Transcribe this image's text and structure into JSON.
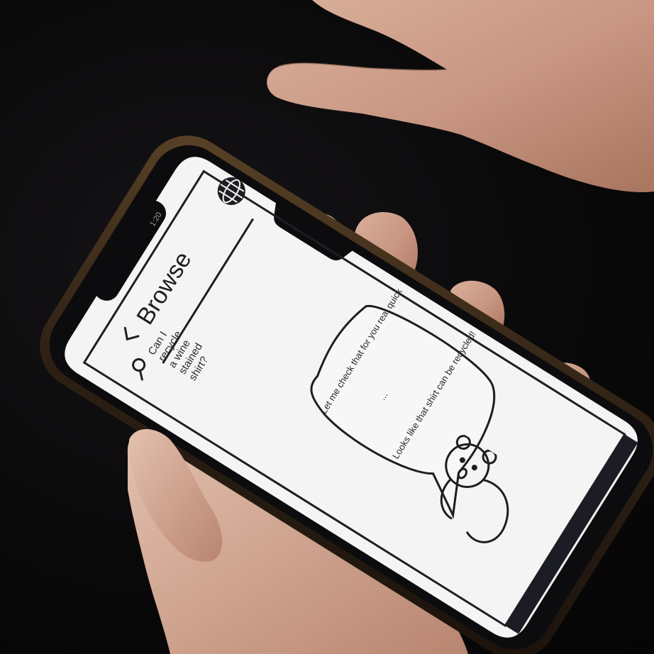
{
  "status_bar": {
    "time": "1:20"
  },
  "header": {
    "back_icon": "chevron-left-icon",
    "title": "Browse",
    "globe_icon": "globe-icon"
  },
  "search": {
    "icon": "search-icon",
    "query": "Can I recycle a wine stained shirt?"
  },
  "assistant": {
    "message_line_1": "Let me check that for you real quick",
    "ellipsis": "...",
    "message_line_2": "Looks like that shirt can be recycled!",
    "mascot_icon": "bear-mascot-icon"
  },
  "colors": {
    "screen": "#f4f4f4",
    "ink": "#1e1e22",
    "phone_frame": "#3b2a18"
  }
}
